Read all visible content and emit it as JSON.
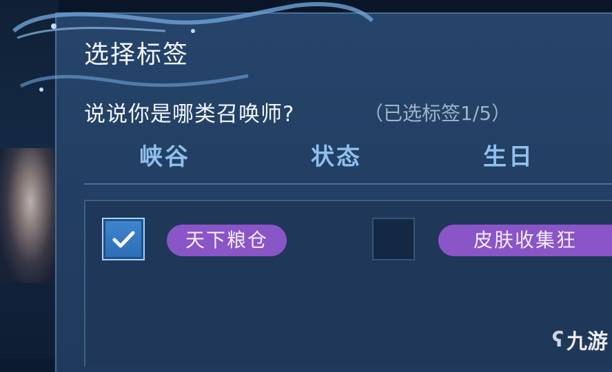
{
  "dialog": {
    "title": "选择标签",
    "question": "说说你是哪类召唤师?",
    "selected_count": "（已选标签1/5）"
  },
  "tabs": [
    {
      "label": "峡谷"
    },
    {
      "label": "状态"
    },
    {
      "label": "生日"
    }
  ],
  "tag_options": [
    {
      "label": "天下粮仓",
      "checked": true
    },
    {
      "label": "皮肤收集狂",
      "checked": false
    }
  ],
  "watermark": {
    "text": "九游"
  },
  "colors": {
    "panel": "#223e62",
    "tab_text": "#8fc0ee",
    "tag_bg": "#8a55c7",
    "checkbox_checked": "#3f86d0"
  }
}
